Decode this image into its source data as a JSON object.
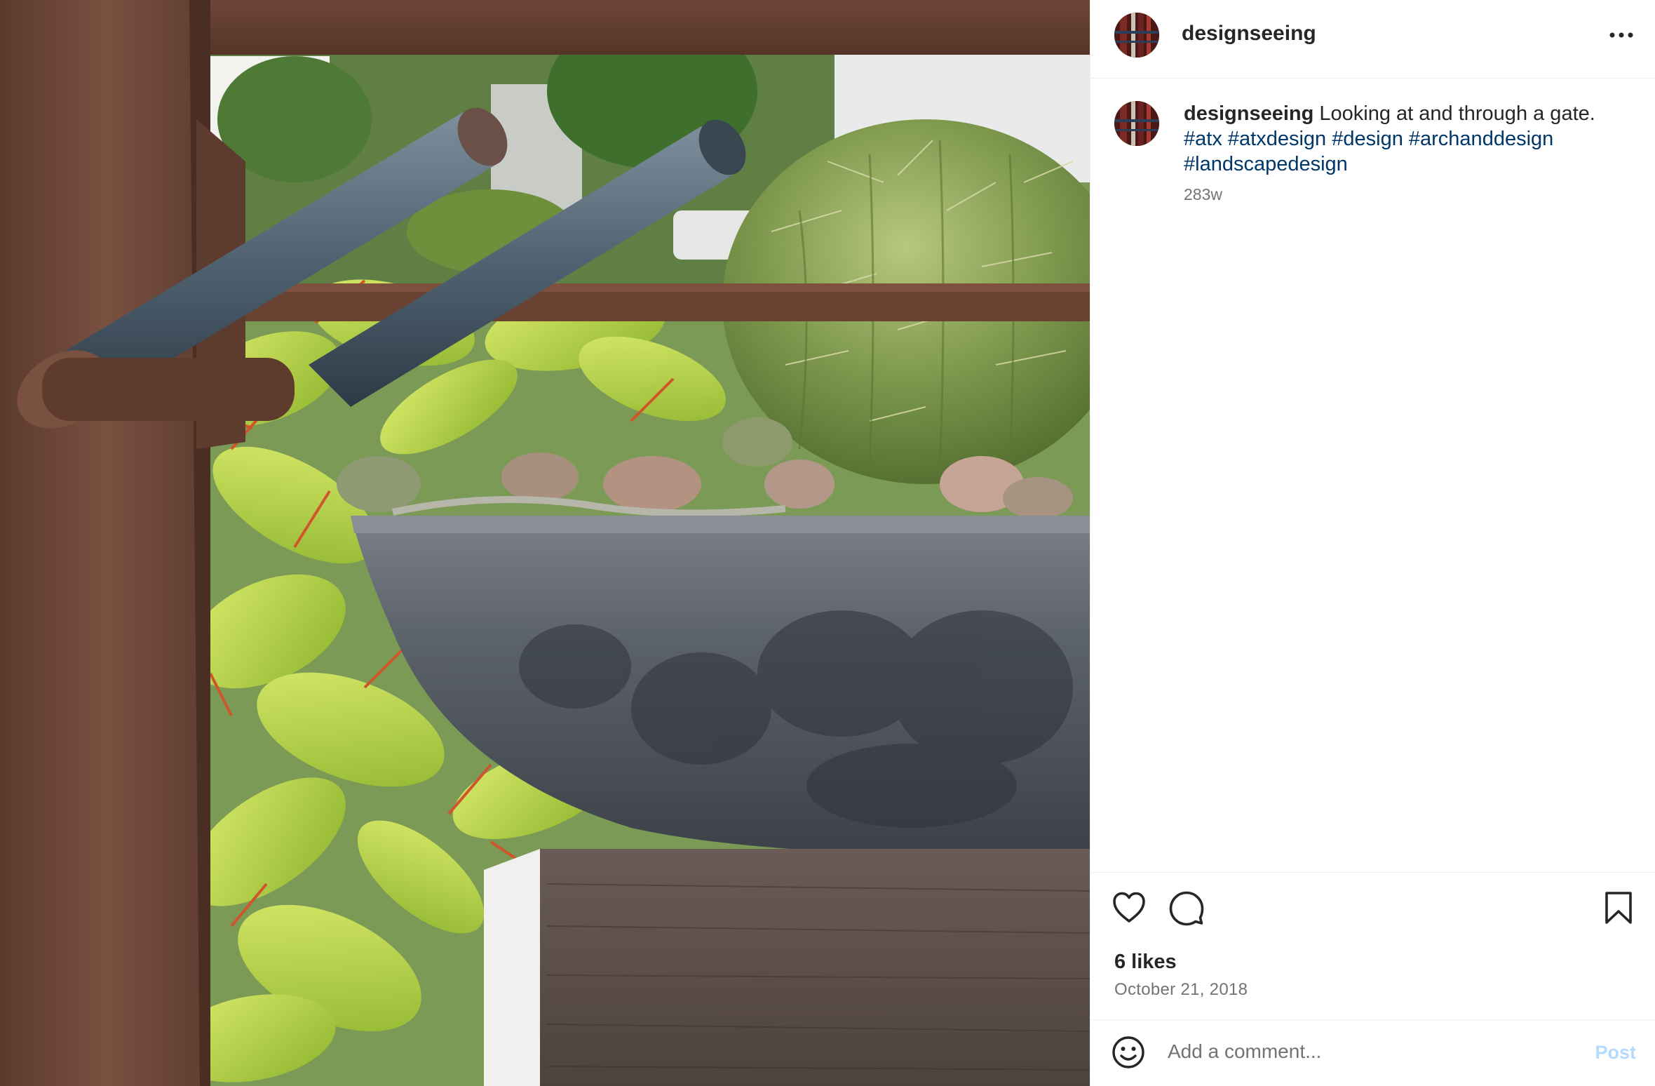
{
  "post": {
    "username": "designseeing",
    "caption": {
      "username": "designseeing",
      "text": " Looking at and through a gate.",
      "hashtags": [
        "#atx",
        "#atxdesign",
        "#design",
        "#archanddesign",
        "#landscapedesign"
      ]
    },
    "age": "283w",
    "likes": "6 likes",
    "date": "October 21, 2018"
  },
  "comment_bar": {
    "placeholder": "Add a comment...",
    "post_label": "Post"
  },
  "colors": {
    "text_primary": "#262626",
    "text_secondary": "#737373",
    "hashtag": "#00376b",
    "post_button_disabled": "#b3dbff",
    "divider": "#efefef"
  },
  "icons": {
    "header": "more-horizontal-icon",
    "actions": [
      "heart-icon",
      "comment-icon",
      "bookmark-icon"
    ],
    "comment_bar": "emoji-icon"
  }
}
